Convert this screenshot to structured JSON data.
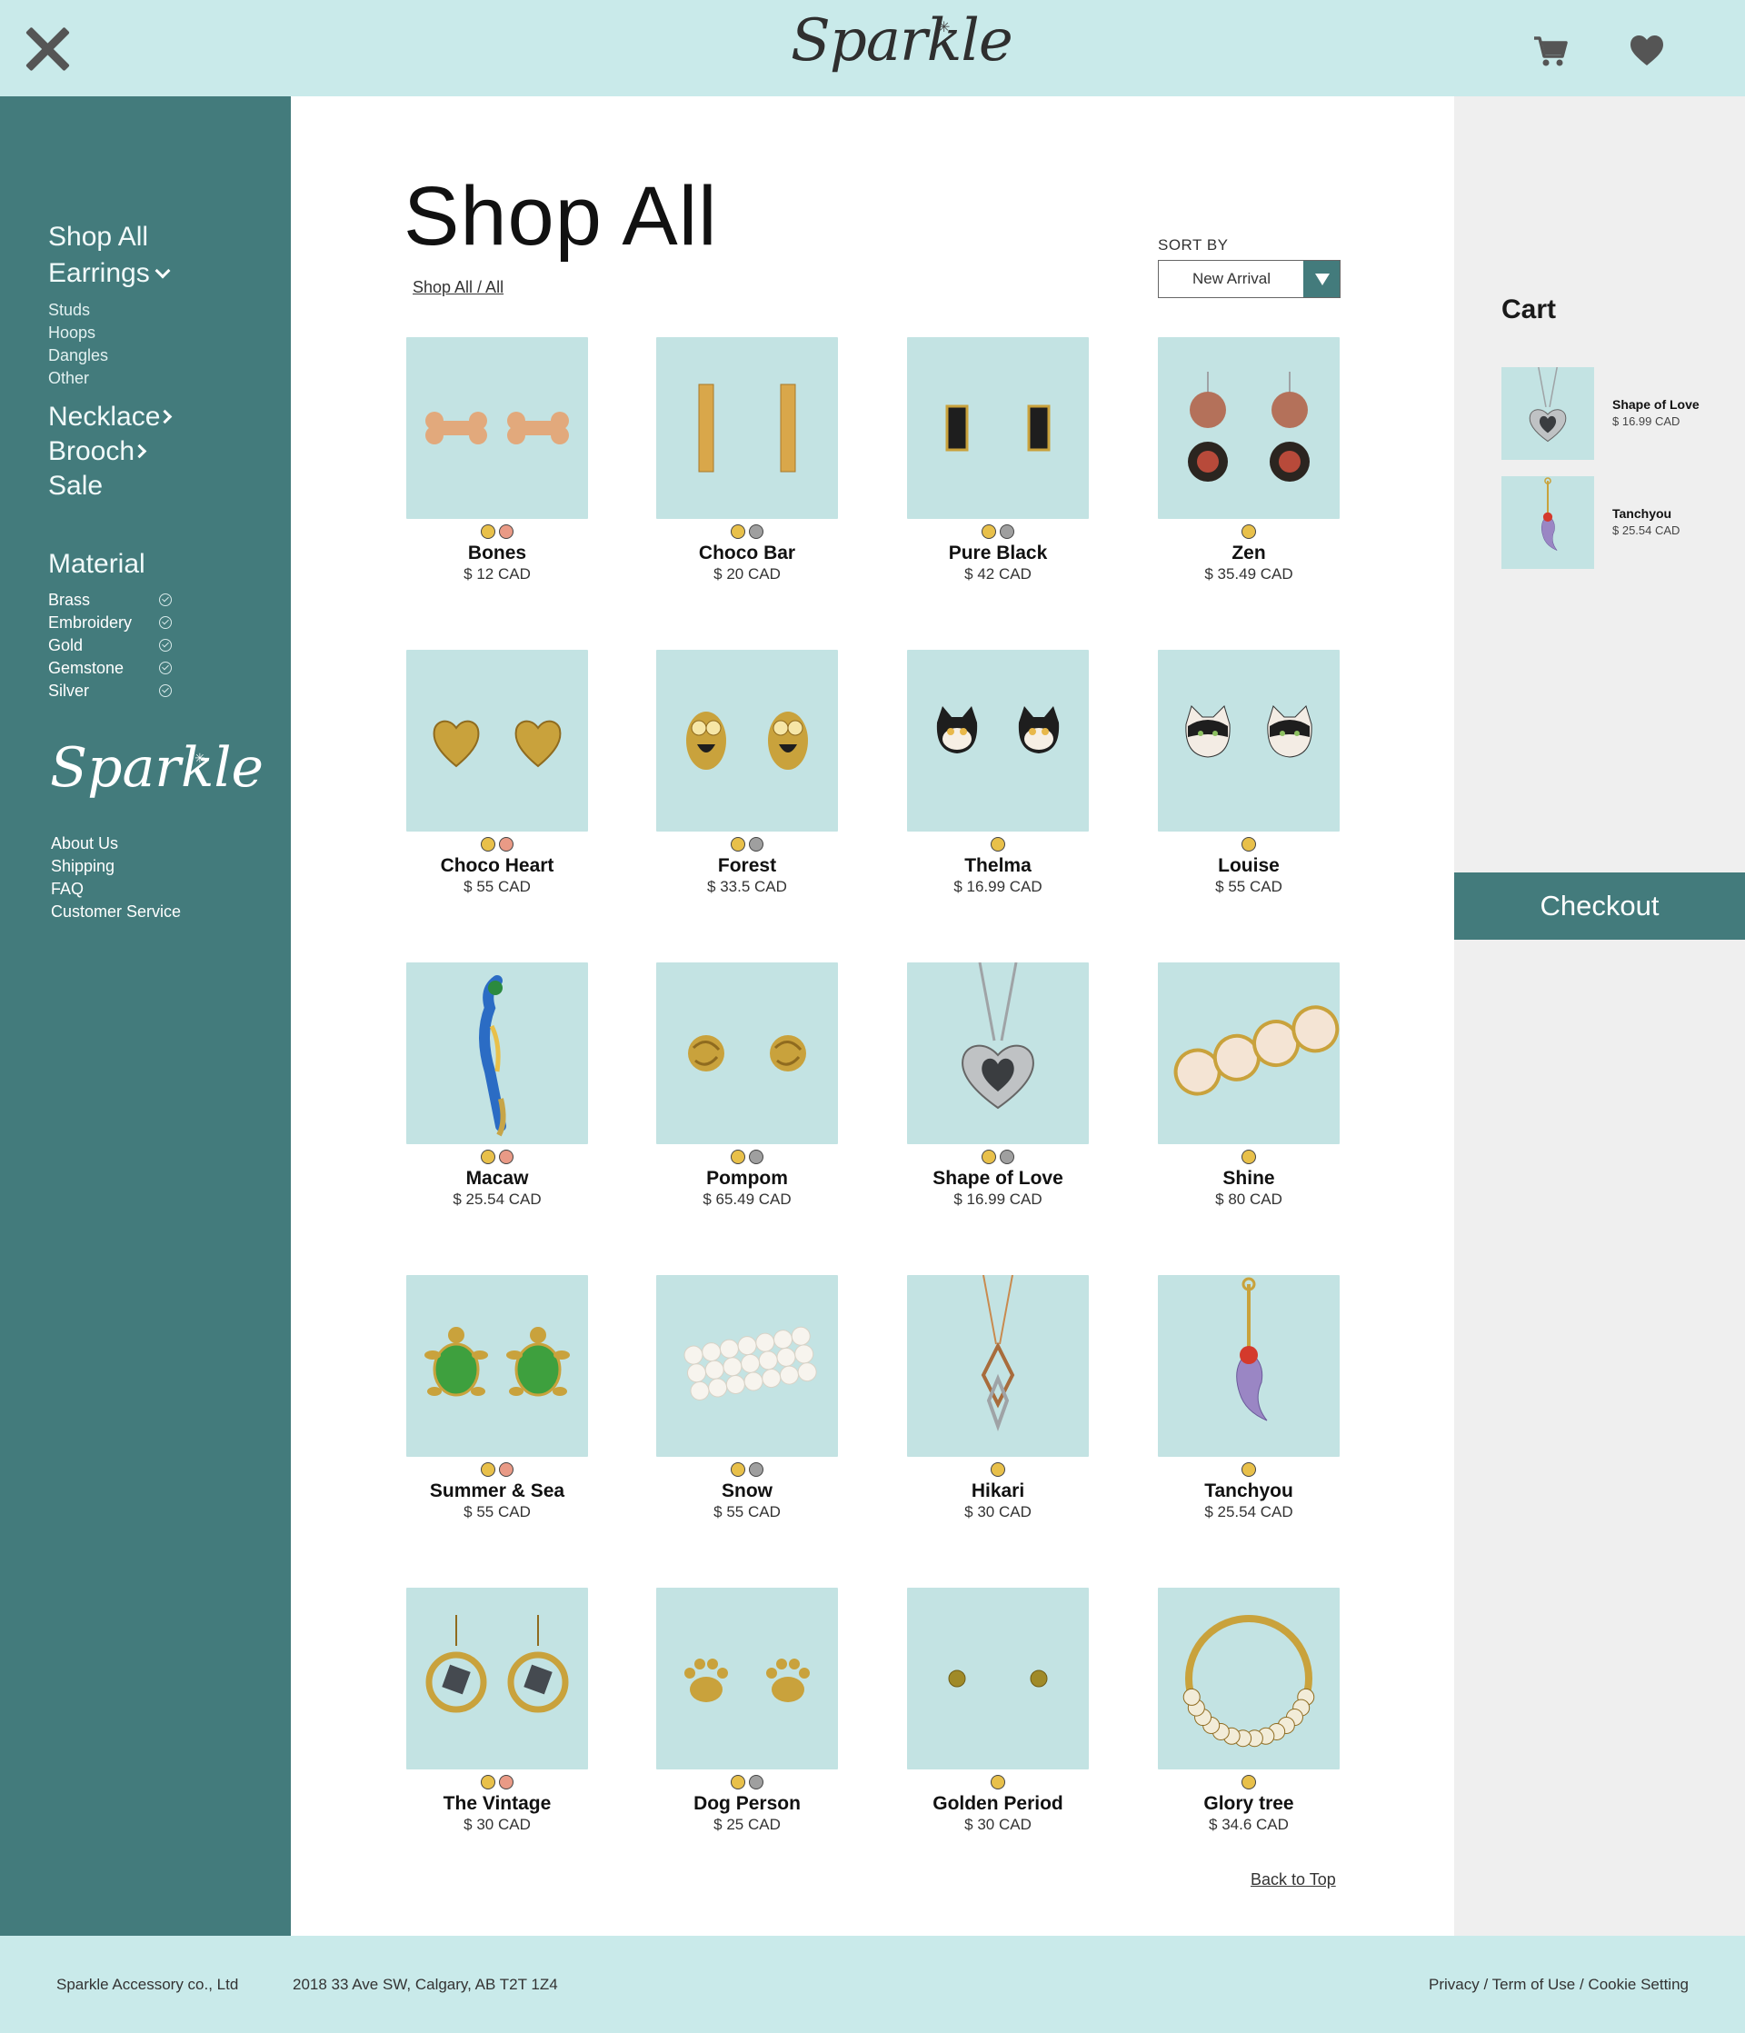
{
  "header": {
    "brand": "Sparkle",
    "brand_star": "✳"
  },
  "sidebar": {
    "nav": [
      {
        "label": "Shop All"
      },
      {
        "label": "Earrings"
      },
      {
        "label": "Necklace"
      },
      {
        "label": "Brooch"
      },
      {
        "label": "Sale"
      }
    ],
    "earrings_sub": [
      "Studs",
      "Hoops",
      "Dangles",
      "Other"
    ],
    "material_title": "Material",
    "materials": [
      "Brass",
      "Embroidery",
      "Gold",
      "Gemstone",
      "Silver"
    ],
    "brand": "Sparkle",
    "footer_links": [
      "About Us",
      "Shipping",
      "FAQ",
      "Customer Service"
    ]
  },
  "main": {
    "title": "Shop All",
    "breadcrumb": "Shop All / All",
    "sort_label": "SORT BY",
    "sort_value": "New Arrival",
    "back_to_top": "Back to Top",
    "products": [
      {
        "name": "Bones",
        "price": "$ 12 CAD",
        "swatches": [
          "#e8c04a",
          "#e99a86"
        ],
        "icon": "bone-earrings"
      },
      {
        "name": "Choco Bar",
        "price": "$ 20 CAD",
        "swatches": [
          "#e8c04a",
          "#9f9f9f"
        ],
        "icon": "bar-earrings"
      },
      {
        "name": "Pure Black",
        "price": "$ 42 CAD",
        "swatches": [
          "#e8c04a",
          "#9f9f9f"
        ],
        "icon": "black-rectangle-earrings"
      },
      {
        "name": "Zen",
        "price": "$ 35.49 CAD",
        "swatches": [
          "#e8c04a"
        ],
        "icon": "disc-dangle-earrings"
      },
      {
        "name": "Choco Heart",
        "price": "$ 55 CAD",
        "swatches": [
          "#e8c04a",
          "#e99a86"
        ],
        "icon": "heart-earrings"
      },
      {
        "name": "Forest",
        "price": "$ 33.5 CAD",
        "swatches": [
          "#e8c04a",
          "#9f9f9f"
        ],
        "icon": "owl-earrings"
      },
      {
        "name": "Thelma",
        "price": "$ 16.99 CAD",
        "swatches": [
          "#e8c04a"
        ],
        "icon": "cat-earrings"
      },
      {
        "name": "Louise",
        "price": "$ 55 CAD",
        "swatches": [
          "#e8c04a"
        ],
        "icon": "cat-face-earrings"
      },
      {
        "name": "Macaw",
        "price": "$ 25.54 CAD",
        "swatches": [
          "#e8c04a",
          "#e99a86"
        ],
        "icon": "parrot-brooch"
      },
      {
        "name": "Pompom",
        "price": "$ 65.49 CAD",
        "swatches": [
          "#e8c04a",
          "#9f9f9f"
        ],
        "icon": "knot-earrings"
      },
      {
        "name": "Shape of Love",
        "price": "$ 16.99 CAD",
        "swatches": [
          "#e8c04a",
          "#9f9f9f"
        ],
        "icon": "heart-necklace"
      },
      {
        "name": "Shine",
        "price": "$ 80 CAD",
        "swatches": [
          "#e8c04a"
        ],
        "icon": "crystal-hairclip"
      },
      {
        "name": "Summer & Sea",
        "price": "$ 55 CAD",
        "swatches": [
          "#e8c04a",
          "#e99a86"
        ],
        "icon": "turtle-earrings"
      },
      {
        "name": "Snow",
        "price": "$ 55 CAD",
        "swatches": [
          "#e8c04a",
          "#9f9f9f"
        ],
        "icon": "pearl-hairclip"
      },
      {
        "name": "Hikari",
        "price": "$ 30 CAD",
        "swatches": [
          "#e8c04a"
        ],
        "icon": "geometric-necklace"
      },
      {
        "name": "Tanchyou",
        "price": "$ 25.54 CAD",
        "swatches": [
          "#e8c04a"
        ],
        "icon": "koi-brooch"
      },
      {
        "name": "The Vintage",
        "price": "$ 30 CAD",
        "swatches": [
          "#e8c04a",
          "#e99a86"
        ],
        "icon": "hoop-dangle-earrings"
      },
      {
        "name": "Dog Person",
        "price": "$ 25 CAD",
        "swatches": [
          "#e8c04a",
          "#9f9f9f"
        ],
        "icon": "paw-earrings"
      },
      {
        "name": "Golden Period",
        "price": "$ 30 CAD",
        "swatches": [
          "#e8c04a"
        ],
        "icon": "ball-stud-earrings"
      },
      {
        "name": "Glory tree",
        "price": "$ 34.6 CAD",
        "swatches": [
          "#e8c04a"
        ],
        "icon": "flower-hoop-earring"
      }
    ]
  },
  "cart": {
    "title": "Cart",
    "items": [
      {
        "name": "Shape of Love",
        "price": "$ 16.99 CAD",
        "icon": "heart-necklace"
      },
      {
        "name": "Tanchyou",
        "price": "$ 25.54 CAD",
        "icon": "koi-brooch"
      }
    ],
    "checkout_label": "Checkout"
  },
  "footer": {
    "company": "Sparkle Accessory co., Ltd",
    "address": "2018 33 Ave SW, Calgary, AB T2T 1Z4",
    "legal": "Privacy / Term of Use / Cookie Setting"
  },
  "colors": {
    "header_bg": "#c9eaea",
    "sidebar_bg": "#437b7c",
    "accent": "#437b7c",
    "cart_bg": "#efefef",
    "product_bg": "#c3e3e3"
  }
}
